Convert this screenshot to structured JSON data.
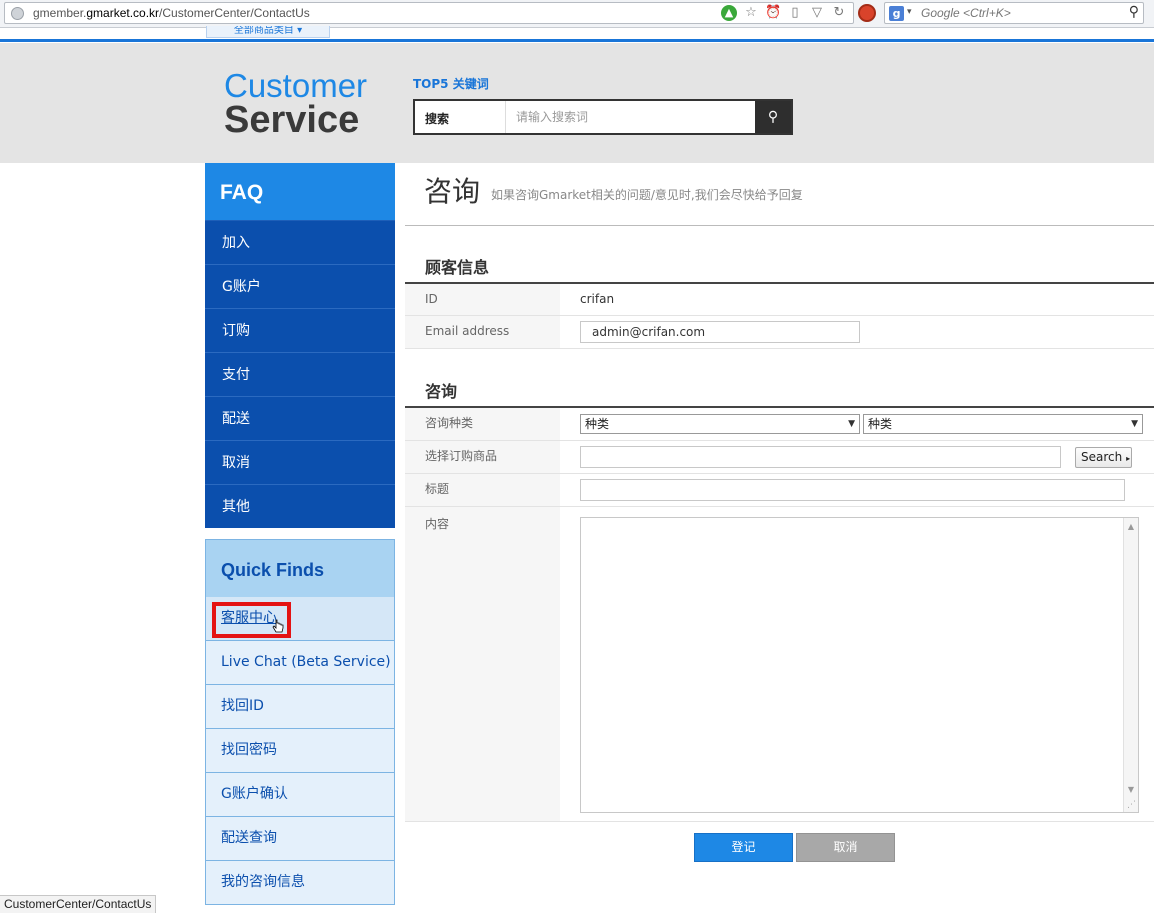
{
  "browser": {
    "url_prefix": "gmember.",
    "url_domain": "gmarket.co.kr",
    "url_path": "/CustomerCenter/ContactUs",
    "search_engine_letter": "g",
    "search_placeholder": "Google <Ctrl+K>",
    "status_text": "CustomerCenter/ContactUs"
  },
  "header": {
    "top_tab": "全部商品类目 ▾",
    "logo_line1": "Customer",
    "logo_line2": "Service",
    "top5_label": "TOP5 关键词",
    "search_label": "搜索",
    "search_placeholder": "请输入搜索词"
  },
  "sidebar": {
    "faq_title": "FAQ",
    "faq_items": [
      "加入",
      "G账户",
      "订购",
      "支付",
      "配送",
      "取消",
      "其他"
    ],
    "quick_title": "Quick Finds",
    "quick_items": [
      "客服中心",
      "Live Chat (Beta Service)",
      "找回ID",
      "找回密码",
      "G账户确认",
      "配送查询",
      "我的咨询信息"
    ]
  },
  "main": {
    "title": "咨询",
    "subtitle": "如果咨询Gmarket相关的问题/意见时,我们会尽快给予回复",
    "customer_section": "顾客信息",
    "id_label": "ID",
    "id_value": "crifan",
    "email_label": "Email address",
    "email_value": "admin@crifan.com",
    "inquiry_section": "咨询",
    "type_label": "咨询种类",
    "type_select_1": "种类",
    "type_select_2": "种类",
    "product_label": "选择订购商品",
    "product_search_button": "Search",
    "subject_label": "标题",
    "content_label": "内容",
    "submit_button": "登记",
    "cancel_button": "取消"
  },
  "colors": {
    "brand_blue": "#1e88e5",
    "faq_dark_blue": "#0b4fad",
    "highlight_red": "#e41313"
  }
}
